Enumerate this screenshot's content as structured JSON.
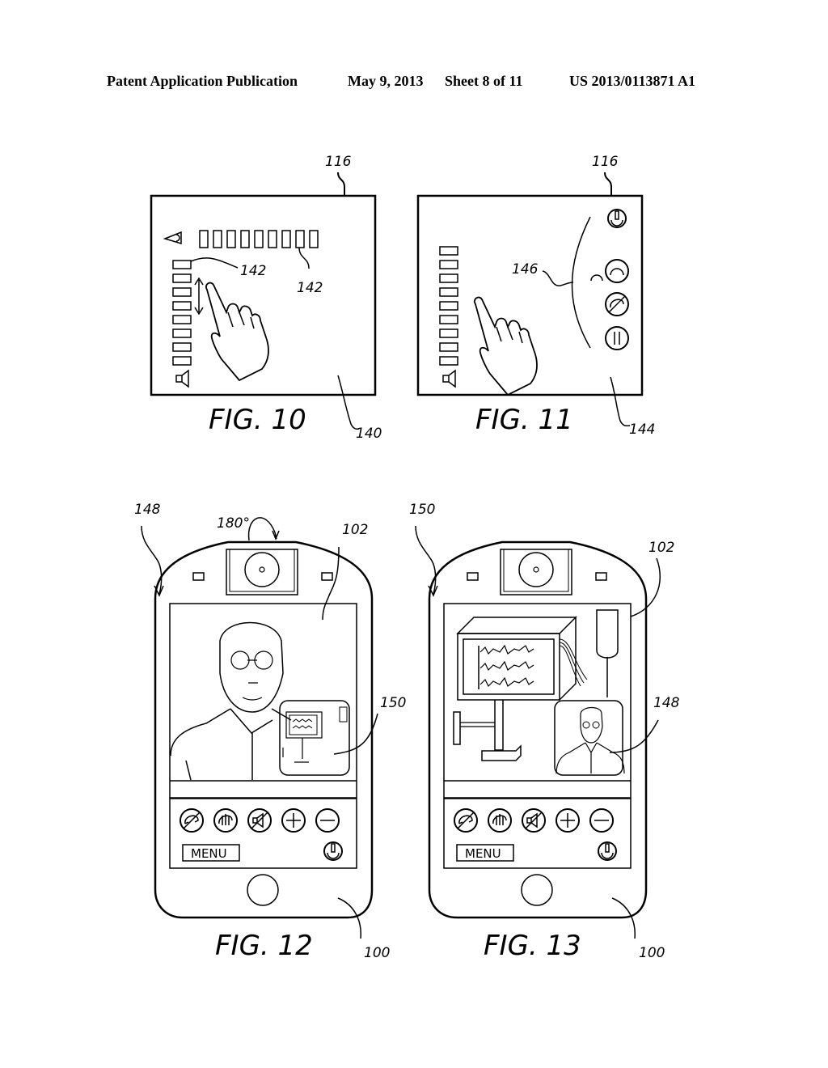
{
  "header": {
    "left": "Patent Application Publication",
    "date": "May 9, 2013",
    "sheet": "Sheet 8 of 11",
    "pub_number": "US 2013/0113871 A1"
  },
  "figures": {
    "fig10": {
      "label": "FIG. 10",
      "refs": {
        "screen": "116",
        "display": "140",
        "bar_a": "142",
        "bar_b": "142"
      },
      "icons": [
        "eye-icon",
        "speaker-icon",
        "hand-pointer-icon",
        "up-down-arrow-icon"
      ]
    },
    "fig11": {
      "label": "FIG. 11",
      "refs": {
        "screen": "116",
        "display": "144",
        "arc": "146"
      },
      "icons": [
        "power-icon",
        "headset-small-icon",
        "headset-icon",
        "hangup-icon",
        "pause-icon",
        "speaker-icon",
        "hand-pointer-icon"
      ]
    },
    "fig12": {
      "label": "FIG. 12",
      "refs": {
        "view": "148",
        "screen": "102",
        "device": "100",
        "pip": "150"
      },
      "rotation": "180°",
      "menu_label": "MENU",
      "buttons": [
        "hangup-icon",
        "hold-icon",
        "mute-icon",
        "plus-icon",
        "minus-icon"
      ]
    },
    "fig13": {
      "label": "FIG. 13",
      "refs": {
        "view": "150",
        "screen": "102",
        "device": "100",
        "pip": "148"
      },
      "menu_label": "MENU",
      "buttons": [
        "hangup-icon",
        "hold-icon",
        "mute-icon",
        "plus-icon",
        "minus-icon"
      ]
    }
  }
}
